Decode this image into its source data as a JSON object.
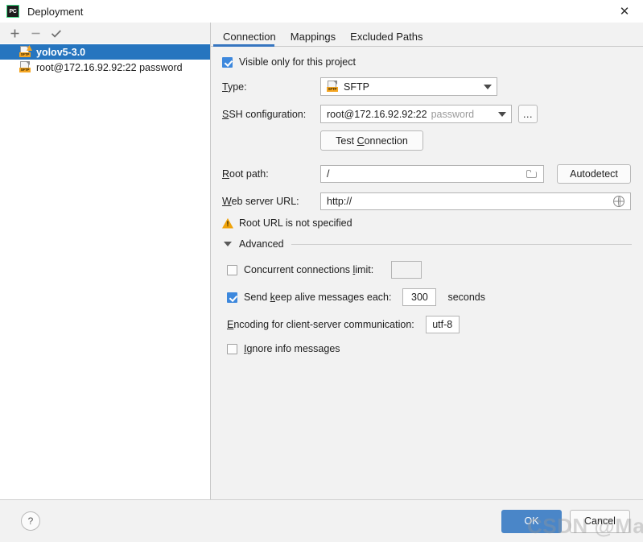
{
  "window": {
    "title": "Deployment",
    "app_icon": "pycharm-icon",
    "app_icon_text": "PC",
    "close_icon": "✕"
  },
  "sidebar": {
    "toolbar": [
      {
        "name": "add-button",
        "glyph": "+"
      },
      {
        "name": "remove-button",
        "glyph": "−"
      },
      {
        "name": "apply-button",
        "glyph": "✓"
      }
    ],
    "items": [
      {
        "label": "yolov5-3.0",
        "icon": "sftp-server-warning-icon",
        "selected": true,
        "warning": true
      },
      {
        "label": "root@172.16.92.92:22 password",
        "icon": "sftp-server-icon",
        "selected": false,
        "warning": false
      }
    ]
  },
  "tabs": [
    {
      "label": "Connection",
      "active": true
    },
    {
      "label": "Mappings",
      "active": false
    },
    {
      "label": "Excluded Paths",
      "active": false
    }
  ],
  "connection": {
    "visible_only_label": "Visible only for this project",
    "visible_only_checked": true,
    "type_label": "Type:",
    "type_label_mnemonic": "T",
    "type_value": "SFTP",
    "type_icon": "sftp-icon",
    "ssh_config_label": "SSH configuration:",
    "ssh_config_value": "root@172.16.92.92:22",
    "ssh_config_suffix": "password",
    "ssh_browse_label": "...",
    "test_connection_label": "Test Connection",
    "root_path_label": "Root path:",
    "root_path_value": "/",
    "root_path_icon": "folder-icon",
    "autodetect_label": "Autodetect",
    "web_url_label": "Web server URL:",
    "web_url_value": "http://",
    "web_url_icon": "globe-icon",
    "warning_text": "Root URL is not specified",
    "warning_icon": "warning-triangle-icon",
    "advanced_label": "Advanced",
    "advanced_expanded": true,
    "concurrent_label": "Concurrent connections limit:",
    "concurrent_checked": false,
    "concurrent_value": "",
    "keepalive_label": "Send keep alive messages each:",
    "keepalive_checked": true,
    "keepalive_value": "300",
    "keepalive_unit": "seconds",
    "encoding_label": "Encoding for client-server communication:",
    "encoding_value": "utf-8",
    "ignore_info_label": "Ignore info messages",
    "ignore_info_checked": false
  },
  "footer": {
    "help_label": "?",
    "ok_label": "OK",
    "cancel_label": "Cancel"
  },
  "watermark": {
    "text": "CSDN @Malax"
  },
  "colors": {
    "selection_blue": "#2675bf",
    "tab_accent": "#3675c0",
    "checkbox_blue": "#3d88dd",
    "primary_button": "#4a86c8",
    "warning_orange": "#f0a30a",
    "sftp_badge": "#f5a623"
  }
}
